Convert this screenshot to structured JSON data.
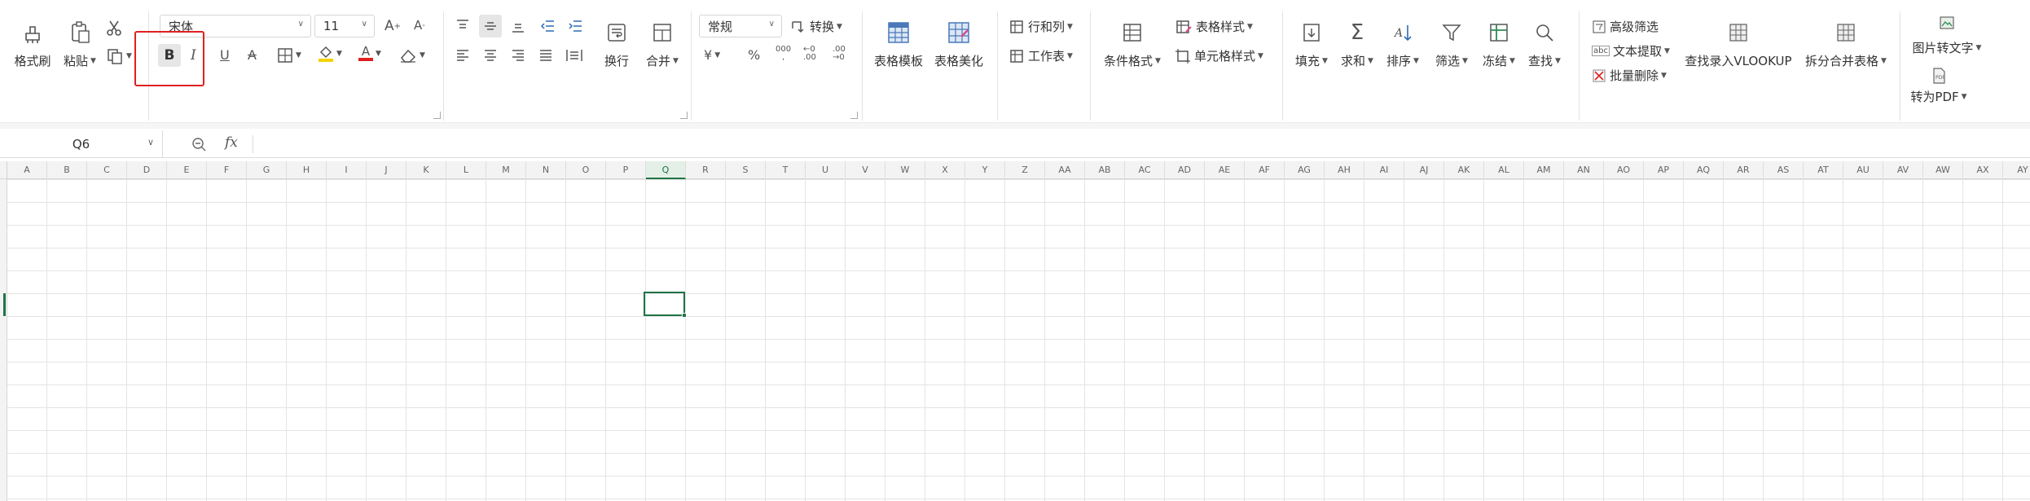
{
  "ribbon": {
    "format_painter": "格式刷",
    "paste": "粘贴",
    "font_name": "宋体",
    "font_size": "11",
    "wrap": "换行",
    "merge": "合并",
    "number_format": "常规",
    "convert": "转换",
    "table_template": "表格模板",
    "table_beautify": "表格美化",
    "row_col": "行和列",
    "worksheet": "工作表",
    "cond_format": "条件格式",
    "table_style": "表格样式",
    "cell_style": "单元格样式",
    "fill": "填充",
    "sum": "求和",
    "sort": "排序",
    "filter": "筛选",
    "freeze": "冻结",
    "find": "查找",
    "adv_filter": "高级筛选",
    "text_extract": "文本提取",
    "batch_delete": "批量删除",
    "vlookup": "查找录入VLOOKUP",
    "split_merge": "拆分合并表格",
    "img_to_text": "图片转文字",
    "to_pdf": "转为PDF"
  },
  "formula_bar": {
    "name_box": "Q6",
    "fx": "fx"
  },
  "columns": [
    "A",
    "B",
    "C",
    "D",
    "E",
    "F",
    "G",
    "H",
    "I",
    "J",
    "K",
    "L",
    "M",
    "N",
    "O",
    "P",
    "Q",
    "R",
    "S",
    "T",
    "U",
    "V",
    "W",
    "X",
    "Y",
    "Z",
    "AA",
    "AB",
    "AC",
    "AD",
    "AE",
    "AF",
    "AG",
    "AH",
    "AI",
    "AJ",
    "AK",
    "AL",
    "AM",
    "AN",
    "AO",
    "AP",
    "AQ",
    "AR",
    "AS",
    "AT",
    "AU",
    "AV",
    "AW",
    "AX",
    "AY"
  ],
  "selected_cell": "Q6",
  "colors": {
    "accent": "#217346",
    "highlight_box": "#e02020",
    "font_color": "#e02020",
    "fill_color": "#f5d200"
  }
}
